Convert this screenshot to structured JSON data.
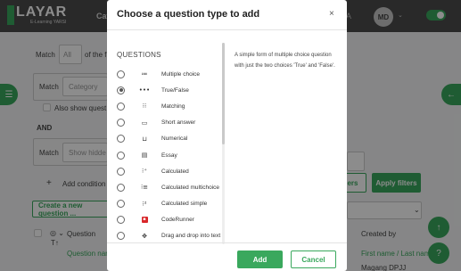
{
  "header": {
    "logo_name": "LAYAR",
    "logo_sub": "E-Learning YARSI",
    "category_label": "Cat",
    "fragment": "A",
    "user_initials": "MD"
  },
  "background": {
    "match_label": "Match",
    "match_select": "All",
    "of_the_text": "of the f",
    "category_match_label": "Match",
    "category_placeholder": "Category",
    "also_show_label": "Also show quest",
    "and_label": "AND",
    "condition_match_label": "Match",
    "show_hidden_placeholder": "Show hidde",
    "add_condition_label": "Add condition",
    "clear_filters_fragment": "ers",
    "apply_filters_label": "Apply filters",
    "create_question_label": "Create a new question ...",
    "question_col_label": "Question",
    "question_name_fragment": "Question nam",
    "created_by_label": "Created by",
    "created_by_sort": "First name / Last name",
    "created_by_value": "Magang DPJJ"
  },
  "modal": {
    "title": "Choose a question type to add",
    "close_glyph": "×",
    "list_heading": "QUESTIONS",
    "description": "A simple form of multiple choice question with just the two choices 'True' and 'False'.",
    "add_label": "Add",
    "cancel_label": "Cancel",
    "selected_index": 1,
    "question_types": [
      {
        "label": "Multiple choice",
        "icon": "≔"
      },
      {
        "label": "True/False",
        "icon": "•••"
      },
      {
        "label": "Matching",
        "icon": "⁝⁝"
      },
      {
        "label": "Short answer",
        "icon": "▭"
      },
      {
        "label": "Numerical",
        "icon": "⊔"
      },
      {
        "label": "Essay",
        "icon": "▤"
      },
      {
        "label": "Calculated",
        "icon": "⁝⁺"
      },
      {
        "label": "Calculated multichoice",
        "icon": "⁝≡"
      },
      {
        "label": "Calculated simple",
        "icon": "⁝²"
      },
      {
        "label": "CodeRunner",
        "icon": "▪"
      },
      {
        "label": "Drag and drop into text",
        "icon": "✥"
      }
    ]
  },
  "colors": {
    "accent": "#3aa85d",
    "coderunner_icon": "#d9262a"
  }
}
